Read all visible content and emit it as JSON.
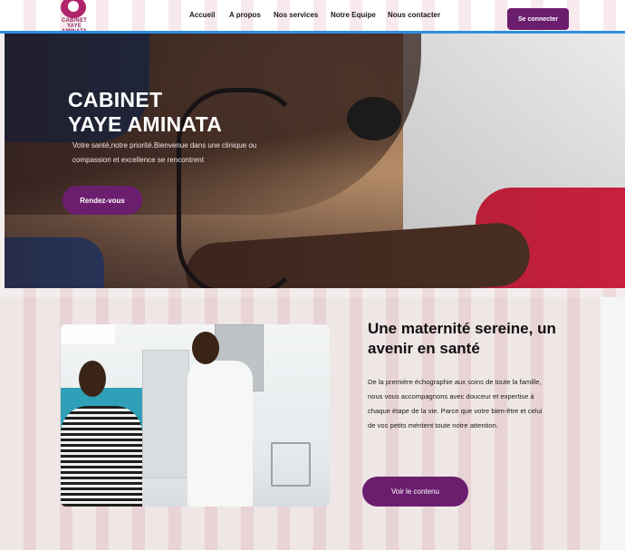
{
  "brand": {
    "logo_text": "CABINET YAYE AMINATA",
    "color": "#6b1e6e"
  },
  "nav": {
    "items": [
      {
        "label": "Accueil"
      },
      {
        "label": "A propos"
      },
      {
        "label": "Nos services"
      },
      {
        "label": "Notre Equipe"
      },
      {
        "label": "Nous contacter"
      }
    ],
    "login_label": "Se connecter"
  },
  "hero": {
    "title_line1": "CABINET",
    "title_line2": "YAYE AMINATA",
    "subtitle": "Votre santé,notre priorité.Bienvenue dans une clinique ou compassion et excellence se rencontrent",
    "cta_label": "Rendez-vous"
  },
  "section": {
    "title": "Une maternité sereine, un avenir en santé",
    "body": "De la première échographie aux soins de toute la famille, nous vous accompagnons avec douceur et expertise à chaque étape de la vie. Parce que votre bien-être et celui de vos petits méritent toute notre attention.",
    "cta_label": "Voir le contenu"
  }
}
